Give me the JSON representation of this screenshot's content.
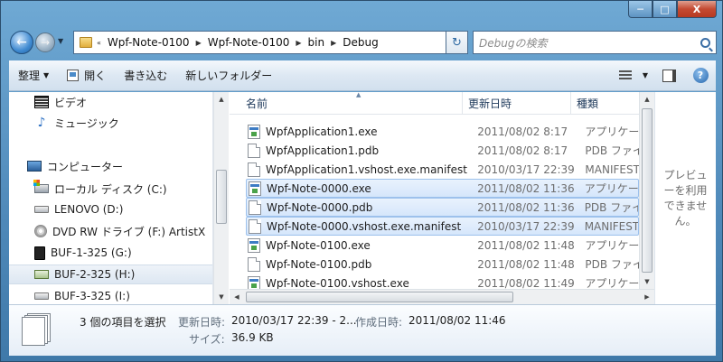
{
  "window": {
    "caption_buttons": {
      "minimize": "─",
      "maximize": "□",
      "close": "X"
    }
  },
  "nav": {
    "back_glyph": "←",
    "forward_glyph": "→",
    "history_glyph": "▼",
    "breadcrumb_prefix": "«",
    "breadcrumbs": [
      "Wpf-Note-0100",
      "Wpf-Note-0100",
      "bin",
      "Debug"
    ],
    "separator_glyph": "▶",
    "refresh_glyph": "↻",
    "search_placeholder": "Debugの検索"
  },
  "toolbar": {
    "organize": "整理",
    "open": "開く",
    "burn": "書き込む",
    "new_folder": "新しいフォルダー",
    "dropdown_glyph": "▼",
    "help_glyph": "?"
  },
  "sidebar": {
    "items": [
      {
        "label": "ビデオ",
        "icon": "video-icon"
      },
      {
        "label": "ミュージック",
        "icon": "music-icon"
      },
      {
        "label": "コンピューター",
        "icon": "computer-icon"
      },
      {
        "label": "ローカル ディスク (C:)",
        "icon": "local-disk-icon"
      },
      {
        "label": "LENOVO (D:)",
        "icon": "drive-icon"
      },
      {
        "label": "DVD RW ドライブ (F:) ArtistX",
        "icon": "dvd-icon"
      },
      {
        "label": "BUF-1-325 (G:)",
        "icon": "hdd-icon"
      },
      {
        "label": "BUF-2-325 (H:)",
        "icon": "network-drive-icon"
      },
      {
        "label": "BUF-3-325 (I:)",
        "icon": "drive-icon"
      }
    ]
  },
  "file_list": {
    "columns": {
      "name": "名前",
      "date": "更新日時",
      "type": "種類"
    },
    "rows": [
      {
        "name": "WpfApplication1.exe",
        "date": "2011/08/02 8:17",
        "type": "アプリケーション",
        "icon": "exe"
      },
      {
        "name": "WpfApplication1.pdb",
        "date": "2011/08/02 8:17",
        "type": "PDB ファイル",
        "icon": "doc"
      },
      {
        "name": "WpfApplication1.vshost.exe.manifest",
        "date": "2010/03/17 22:39",
        "type": "MANIFEST",
        "icon": "doc"
      },
      {
        "name": "Wpf-Note-0000.exe",
        "date": "2011/08/02 11:36",
        "type": "アプリケーション",
        "icon": "exe",
        "selected": true
      },
      {
        "name": "Wpf-Note-0000.pdb",
        "date": "2011/08/02 11:36",
        "type": "PDB ファイル",
        "icon": "doc",
        "selected": true
      },
      {
        "name": "Wpf-Note-0000.vshost.exe.manifest",
        "date": "2010/03/17 22:39",
        "type": "MANIFEST",
        "icon": "doc",
        "selected": true
      },
      {
        "name": "Wpf-Note-0100.exe",
        "date": "2011/08/02 11:48",
        "type": "アプリケーション",
        "icon": "exe"
      },
      {
        "name": "Wpf-Note-0100.pdb",
        "date": "2011/08/02 11:48",
        "type": "PDB ファイル",
        "icon": "doc"
      },
      {
        "name": "Wpf-Note-0100.vshost.exe",
        "date": "2011/08/02 11:49",
        "type": "アプリケーション",
        "icon": "exe"
      }
    ]
  },
  "scroll_glyphs": {
    "up": "▲",
    "down": "▼",
    "left": "◀",
    "right": "▶"
  },
  "preview": {
    "text": "プレビューを利用できません。"
  },
  "details": {
    "selection": "3 個の項目を選択",
    "modified_label": "更新日時:",
    "modified_value": "2010/03/17 22:39 - 2...",
    "created_label": "作成日時:",
    "created_value": "2011/08/02 11:46",
    "size_label": "サイズ:",
    "size_value": "36.9 KB"
  }
}
